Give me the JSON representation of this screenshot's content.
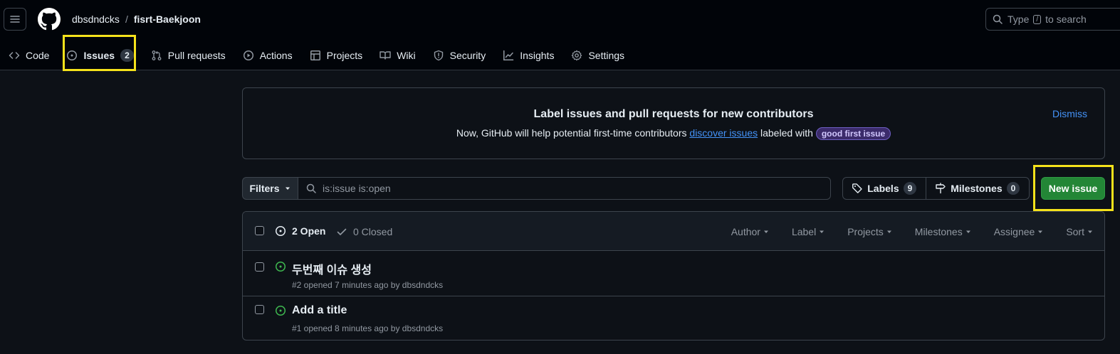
{
  "header": {
    "owner": "dbsdndcks",
    "separator": "/",
    "repo": "fisrt-Baekjoon",
    "search_prefix": "Type",
    "search_key": "/",
    "search_suffix": "to search"
  },
  "nav": {
    "code": "Code",
    "issues": "Issues",
    "issues_count": "2",
    "pulls": "Pull requests",
    "actions": "Actions",
    "projects": "Projects",
    "wiki": "Wiki",
    "security": "Security",
    "insights": "Insights",
    "settings": "Settings"
  },
  "banner": {
    "title": "Label issues and pull requests for new contributors",
    "text_before": "Now, GitHub will help potential first-time contributors",
    "link": "discover issues",
    "text_after": "labeled with",
    "label_pill": "good first issue",
    "dismiss": "Dismiss"
  },
  "toolbar": {
    "filters_label": "Filters",
    "query": "is:issue is:open",
    "labels_label": "Labels",
    "labels_count": "9",
    "milestones_label": "Milestones",
    "milestones_count": "0",
    "new_issue_label": "New issue"
  },
  "list": {
    "open_label": "2 Open",
    "closed_label": "0 Closed",
    "sorts": [
      "Author",
      "Label",
      "Projects",
      "Milestones",
      "Assignee",
      "Sort"
    ],
    "issues": [
      {
        "title": "두번째 이슈 생성",
        "meta": "#2 opened 7 minutes ago by dbsdndcks"
      },
      {
        "title": "Add a title",
        "meta": "#1 opened 8 minutes ago by dbsdndcks"
      }
    ]
  },
  "colors": {
    "accent_green": "#238636",
    "open_icon": "#3fb950",
    "link_blue": "#4493f8",
    "highlight": "#f5e21b"
  }
}
